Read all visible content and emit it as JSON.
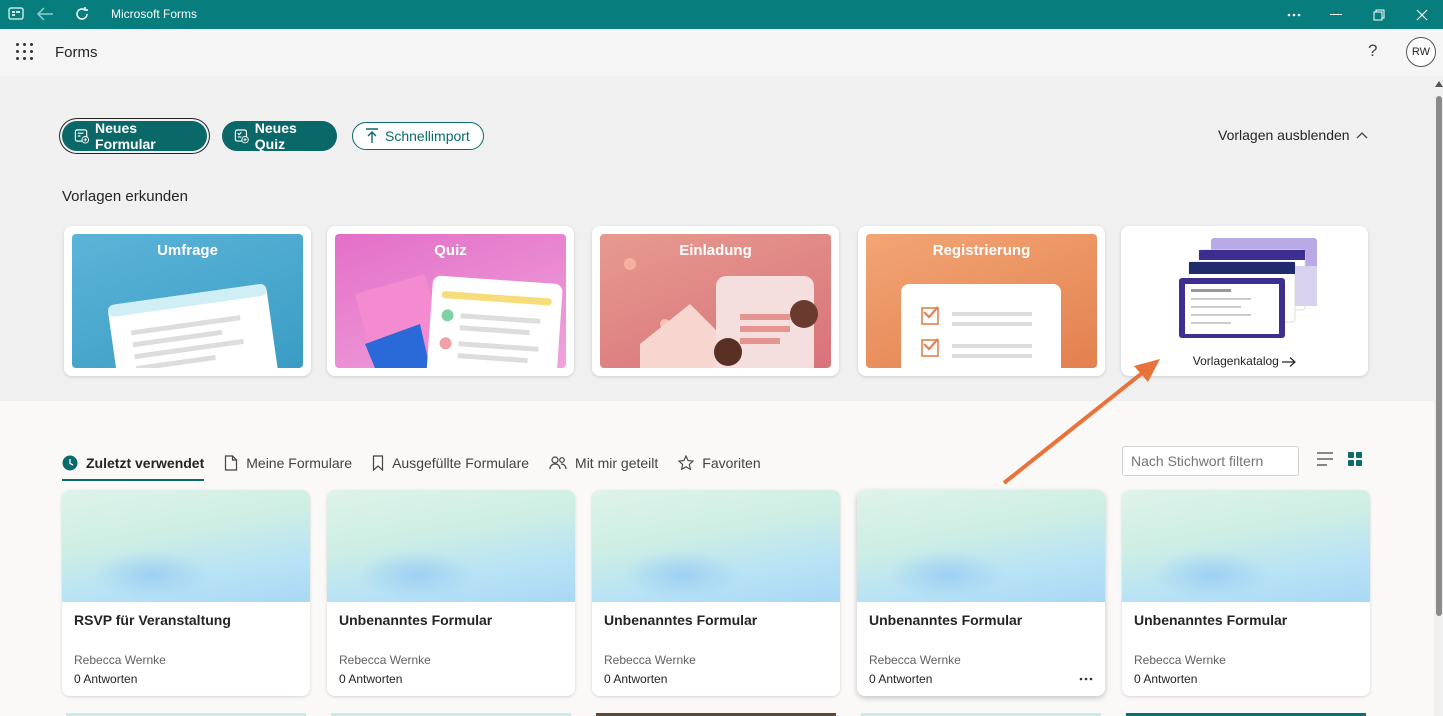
{
  "window": {
    "title": "Microsoft Forms"
  },
  "app": {
    "name": "Forms",
    "help": "?",
    "avatar": "RW"
  },
  "actions": {
    "new_form": "Neues Formular",
    "new_quiz": "Neues Quiz",
    "quick_import": "Schnellimport",
    "hide_templates": "Vorlagen ausblenden"
  },
  "templates": {
    "title": "Vorlagen erkunden",
    "items": [
      {
        "label": "Umfrage"
      },
      {
        "label": "Quiz"
      },
      {
        "label": "Einladung"
      },
      {
        "label": "Registrierung"
      }
    ],
    "catalog": "Vorlagenkatalog"
  },
  "tabs": [
    {
      "label": "Zuletzt verwendet",
      "icon": "clock-icon"
    },
    {
      "label": "Meine Formulare",
      "icon": "document-icon"
    },
    {
      "label": "Ausgefüllte Formulare",
      "icon": "bookmark-icon"
    },
    {
      "label": "Mit mir geteilt",
      "icon": "people-icon"
    },
    {
      "label": "Favoriten",
      "icon": "star-icon"
    }
  ],
  "filter": {
    "placeholder": "Nach Stichwort filtern"
  },
  "forms": [
    {
      "name": "RSVP für Veranstaltung",
      "owner": "Rebecca Wernke",
      "responses": "0 Antworten"
    },
    {
      "name": "Unbenanntes Formular",
      "owner": "Rebecca Wernke",
      "responses": "0 Antworten"
    },
    {
      "name": "Unbenanntes Formular",
      "owner": "Rebecca Wernke",
      "responses": "0 Antworten"
    },
    {
      "name": "Unbenanntes Formular",
      "owner": "Rebecca Wernke",
      "responses": "0 Antworten"
    },
    {
      "name": "Unbenanntes Formular",
      "owner": "Rebecca Wernke",
      "responses": "0 Antworten"
    }
  ],
  "colors": {
    "accent": "#077d7d",
    "annotation_arrow": "#e8733a"
  }
}
